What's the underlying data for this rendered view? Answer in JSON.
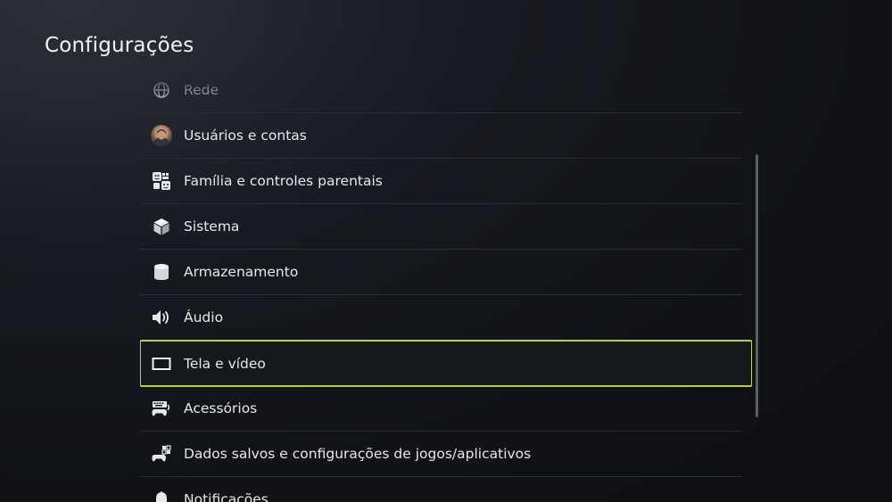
{
  "header": {
    "title": "Configurações"
  },
  "menu": {
    "items": [
      {
        "label": "Rede",
        "icon": "network-globe-icon"
      },
      {
        "label": "Usuários e contas",
        "icon": "user-avatar"
      },
      {
        "label": "Família e controles parentais",
        "icon": "family-icon"
      },
      {
        "label": "Sistema",
        "icon": "system-cube-icon"
      },
      {
        "label": "Armazenamento",
        "icon": "storage-icon"
      },
      {
        "label": "Áudio",
        "icon": "speaker-icon"
      },
      {
        "label": "Tela e vídeo",
        "icon": "display-icon",
        "selected": true
      },
      {
        "label": "Acessórios",
        "icon": "accessories-icon"
      },
      {
        "label": "Dados salvos e configurações de jogos/aplicativos",
        "icon": "saved-data-icon"
      },
      {
        "label": "Notificações",
        "icon": "bell-icon"
      }
    ]
  },
  "colors": {
    "accent": "#b5d334",
    "background": "#101216",
    "text": "#e6e8eb"
  }
}
